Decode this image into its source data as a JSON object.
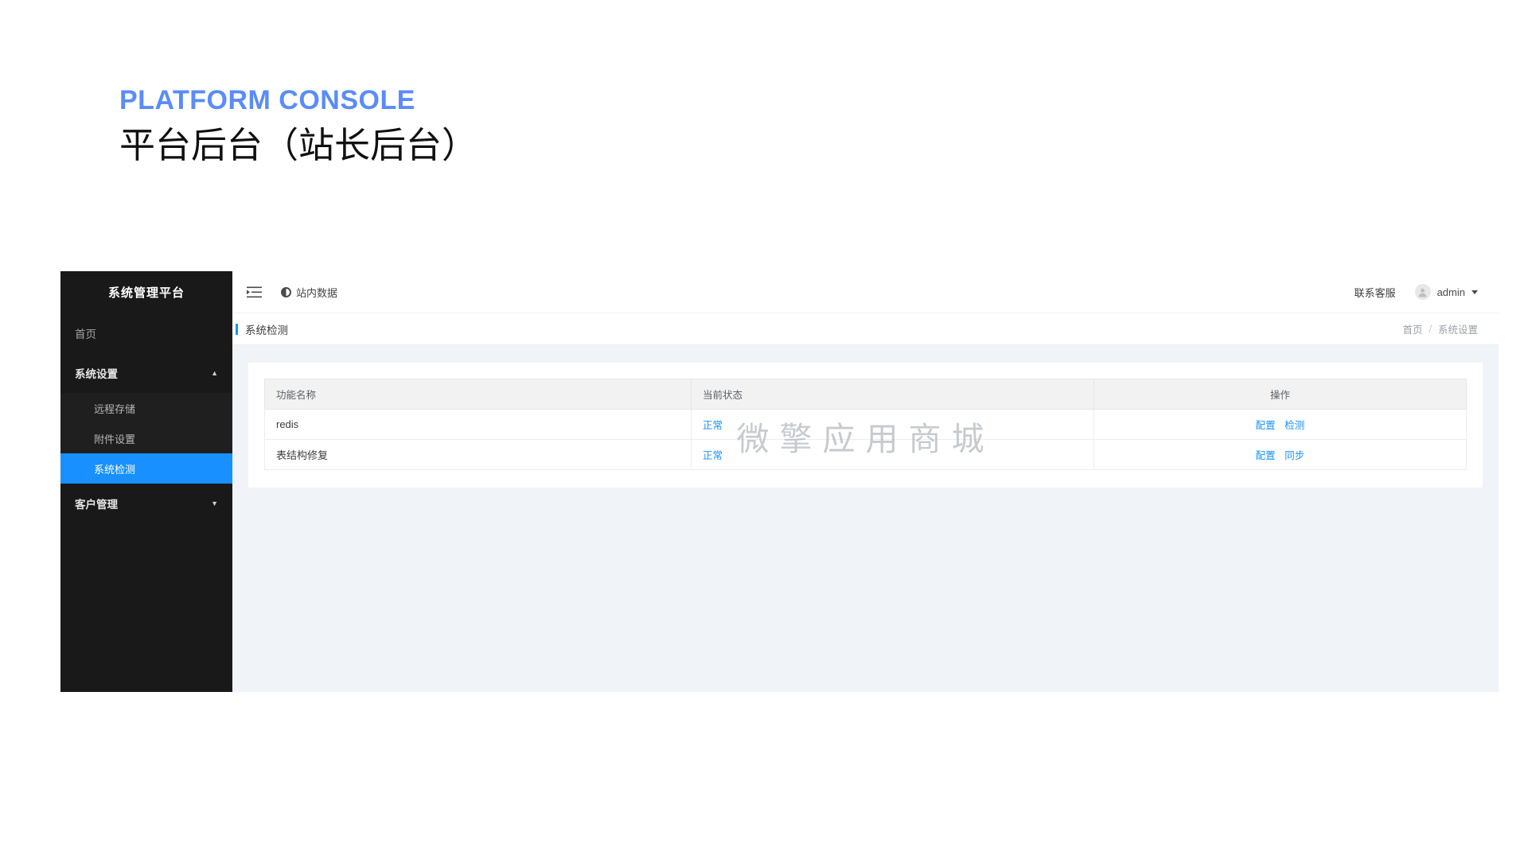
{
  "slide": {
    "kicker": "PLATFORM CONSOLE",
    "headline": "平台后台（站长后台）",
    "accent_color": "#5a8cf8"
  },
  "sidebar": {
    "brand": "系统管理平台",
    "items": [
      {
        "label": "首页",
        "type": "link"
      },
      {
        "label": "系统设置",
        "type": "group",
        "chevron": "chevron-up-icon",
        "expanded": true
      },
      {
        "label": "客户管理",
        "type": "group",
        "chevron": "chevron-down-icon",
        "expanded": false
      }
    ],
    "submenu": [
      {
        "label": "远程存储",
        "active": false
      },
      {
        "label": "附件设置",
        "active": false
      },
      {
        "label": "系统检测",
        "active": true
      }
    ],
    "active_color": "#1890ff",
    "background": "#191919"
  },
  "topbar": {
    "collapse_icon": "menu-collapse-icon",
    "site_data_label": "站内数据",
    "site_data_icon": "contrast-half-circle-icon",
    "support_label": "联系客服",
    "avatar_icon": "user-avatar-icon",
    "user_name": "admin",
    "caret_icon": "caret-down-icon"
  },
  "subbar": {
    "page_title": "系统检测",
    "breadcrumb": [
      {
        "label": "首页"
      },
      {
        "label": "/"
      },
      {
        "label": "系统设置"
      }
    ]
  },
  "table": {
    "columns": [
      "功能名称",
      "当前状态",
      "操作"
    ],
    "rows": [
      {
        "name": "redis",
        "status": "正常",
        "actions": [
          "配置",
          "检测"
        ]
      },
      {
        "name": "表结构修复",
        "status": "正常",
        "actions": [
          "配置",
          "同步"
        ]
      }
    ]
  },
  "watermark": "微擎应用商城"
}
